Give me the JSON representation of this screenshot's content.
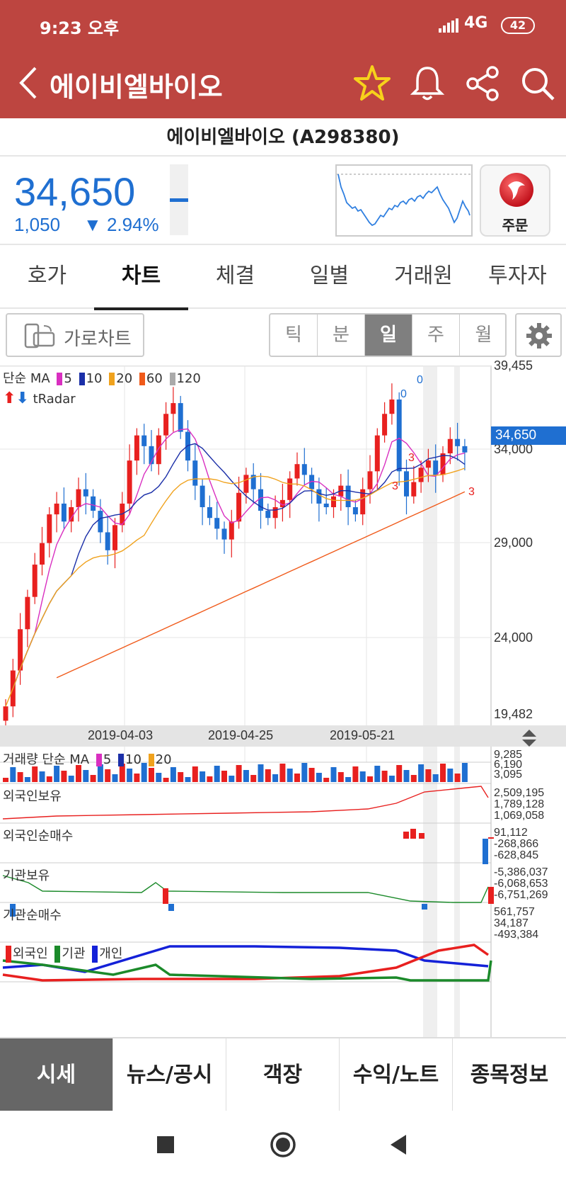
{
  "status_bar": {
    "time": "9:23 오후",
    "network": "4G",
    "battery": "42"
  },
  "app_bar": {
    "title": "에이비엘바이오",
    "icons": [
      "back-icon",
      "star-icon",
      "bell-icon",
      "share-icon",
      "search-icon"
    ]
  },
  "stock": {
    "name_code": "에이비엘바이오 (A298380)"
  },
  "price": {
    "current": "34,650",
    "change": "1,050",
    "change_pct": "▼ 2.94%",
    "change_color": "#1f6fd1",
    "gauge_level": 0.5
  },
  "order_button": {
    "label": "주문"
  },
  "tabs": [
    {
      "label": "호가"
    },
    {
      "label": "차트"
    },
    {
      "label": "체결"
    },
    {
      "label": "일별"
    },
    {
      "label": "거래원"
    },
    {
      "label": "투자자"
    }
  ],
  "toolbar": {
    "landscape_label": "가로차트",
    "periods": [
      "틱",
      "분",
      "일",
      "주",
      "월"
    ],
    "active_period": "일"
  },
  "chart": {
    "legend_ma_prefix": "단순 MA",
    "ma_periods": [
      {
        "label": "5",
        "color": "#d92fc0"
      },
      {
        "label": "10",
        "color": "#1b2fa8"
      },
      {
        "label": "20",
        "color": "#f0a21d"
      },
      {
        "label": "60",
        "color": "#f05a1a"
      },
      {
        "label": "120",
        "color": "#aaaaaa"
      }
    ],
    "tradar_label": "tRadar",
    "y_labels": [
      "39,455",
      "34,000",
      "29,000",
      "24,000",
      "19,482"
    ],
    "price_tag": "34,650",
    "x_dates": [
      "2019-04-03",
      "2019-04-25",
      "2019-05-21"
    ],
    "radar_marks": [
      "0",
      "0",
      "3",
      "3",
      "3"
    ],
    "volume": {
      "label": "거래량 단순 MA",
      "ma": [
        "5",
        "10",
        "20"
      ],
      "values": [
        "9,285",
        "6,190",
        "3,095"
      ]
    },
    "foreign_hold": {
      "label": "외국인보유",
      "values": [
        "2,509,195",
        "1,789,128",
        "1,069,058"
      ]
    },
    "foreign_net": {
      "label": "외국인순매수",
      "values": [
        "91,112",
        "-268,866",
        "-628,845"
      ]
    },
    "inst_hold": {
      "label": "기관보유",
      "values": [
        "-5,386,037",
        "-6,068,653",
        "-6,751,269"
      ]
    },
    "inst_net": {
      "label": "기관순매수",
      "values": [
        "561,757",
        "34,187",
        "-493,384"
      ]
    },
    "investors": {
      "labels": [
        "외국인",
        "기관",
        "개인"
      ],
      "colors": [
        "#e8201f",
        "#1b8a2a",
        "#1421d8"
      ]
    }
  },
  "chart_data": {
    "type": "candlestick",
    "ylim": [
      19482,
      39455
    ],
    "x": [
      "2019-04-03",
      "2019-04-25",
      "2019-05-21"
    ],
    "last_close": 34650
  },
  "bottom_tabs": [
    {
      "label": "시세"
    },
    {
      "label": "뉴스/공시"
    },
    {
      "label": "객장"
    },
    {
      "label": "수익/노트"
    },
    {
      "label": "종목정보"
    }
  ]
}
